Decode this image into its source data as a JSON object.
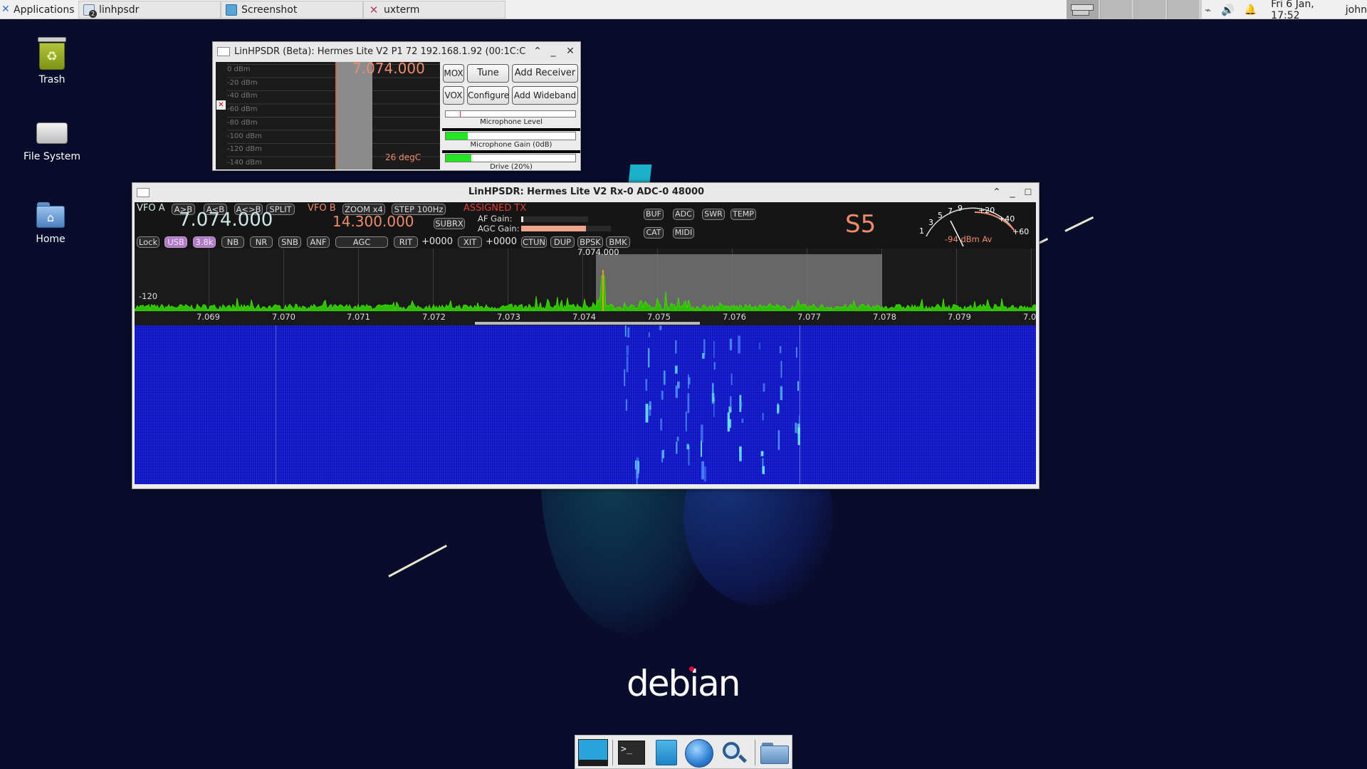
{
  "top_panel": {
    "applications_label": "Applications",
    "tasks": [
      {
        "label": "linhpsdr",
        "badge": "2"
      },
      {
        "label": "Screenshot"
      },
      {
        "label": "uxterm"
      }
    ],
    "clock": "Fri  6 Jan, 17:52",
    "user": "john"
  },
  "desktop": {
    "icons": [
      {
        "label": "Trash"
      },
      {
        "label": "File System"
      },
      {
        "label": "Home"
      }
    ],
    "wallpaper_logo": "debian"
  },
  "small_window": {
    "title": "LinHPSDR (Beta): Hermes Lite V2 P1 72 192.168.1.92 (00:1C:C",
    "frequency": "7.074.000",
    "dbm_labels": [
      "0 dBm",
      "-20 dBm",
      "-40 dBm",
      "-60 dBm",
      "-80 dBm",
      "-100 dBm",
      "-120 dBm",
      "-140 dBm"
    ],
    "temperature": "26 degC",
    "buttons": {
      "mox": "MOX",
      "tune": "Tune",
      "add_receiver": "Add Receiver",
      "vox": "VOX",
      "configure": "Configure",
      "add_wideband": "Add Wideband"
    },
    "mic_level_label": "Microphone Level",
    "mic_gain_label": "Microphone Gain (0dB)",
    "drive_label": "Drive (20%)",
    "mic_gain_fraction": 0.17,
    "drive_fraction": 0.2
  },
  "main_window": {
    "title": "LinHPSDR: Hermes Lite V2 Rx-0 ADC-0 48000",
    "vfo_a_label": "VFO A",
    "vfo_a_freq": "7.074.000",
    "vfo_b_label": "VFO B",
    "vfo_b_freq": "14.300.000",
    "assigned_tx": "ASSIGNED TX",
    "buttons_row1": {
      "a_to_b": "A>B",
      "a_from_b": "A<B",
      "a_swap_b": "A<>B",
      "split": "SPLIT",
      "zoom": "ZOOM x4",
      "step": "STEP 100Hz",
      "subrx": "SUBRX"
    },
    "buttons_row2": {
      "lock": "Lock",
      "usb": "USB",
      "filter": "3.8k",
      "nb": "NB",
      "nr": "NR",
      "snb": "SNB",
      "anf": "ANF",
      "agc": "AGC",
      "rit": "RIT",
      "rit_value": "+0000",
      "xit": "XIT",
      "xit_value": "+0000",
      "ctun": "CTUN",
      "dup": "DUP",
      "bpsk": "BPSK",
      "bmk": "BMK"
    },
    "af_gain_label": "AF Gain:",
    "agc_gain_label": "AGC Gain:",
    "af_gain_fraction": 0.03,
    "agc_gain_fraction": 0.72,
    "right_buttons": {
      "buf": "BUF",
      "adc": "ADC",
      "swr": "SWR",
      "temp": "TEMP",
      "cat": "CAT",
      "midi": "MIDI"
    },
    "s_meter_reading": "S5",
    "meter_scale": [
      "1",
      "3",
      "5",
      "7",
      "9",
      "+20",
      "+40",
      "+60"
    ],
    "meter_average": "-94 dBm Av",
    "panadapter_center": "7.074.000",
    "panadapter_level": "-120",
    "freq_ticks": [
      "7.069",
      "7.070",
      "7.071",
      "7.072",
      "7.073",
      "7.074",
      "7.075",
      "7.076",
      "7.077",
      "7.078",
      "7.079",
      "7.0"
    ]
  },
  "dock": {
    "items": [
      "show-desktop",
      "terminal",
      "file-manager",
      "web-browser",
      "app-finder",
      "folder"
    ]
  },
  "colors": {
    "accent_orange": "#ee8c6c",
    "spectrum_green": "#38d800",
    "vfo_a_cyan": "#cfeaea",
    "waterfall_blue": "#1218c8",
    "active_purple": "#b07ac4"
  }
}
